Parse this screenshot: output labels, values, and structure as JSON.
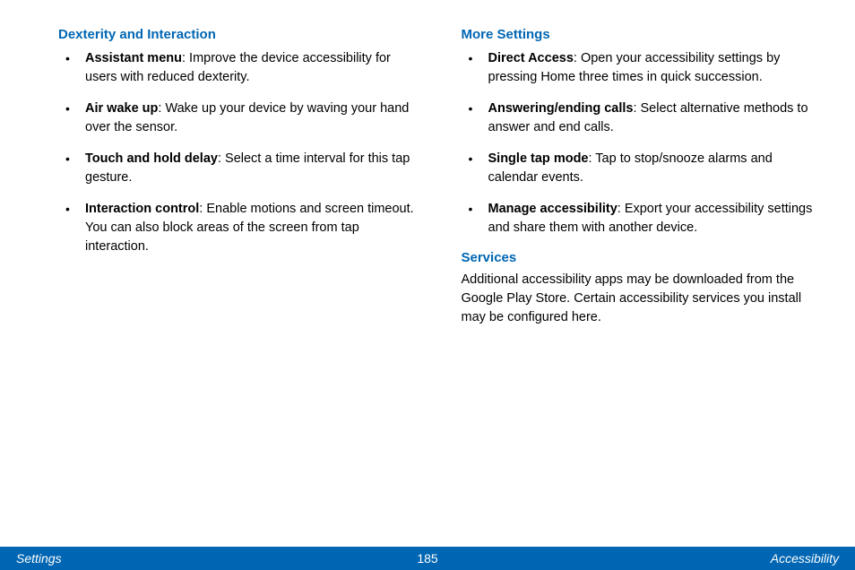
{
  "left": {
    "heading": "Dexterity and Interaction",
    "items": [
      {
        "title": "Assistant menu",
        "desc": ": Improve the device accessibility for users with reduced dexterity."
      },
      {
        "title": "Air wake up",
        "desc": ": Wake up your device by waving your hand over the sensor."
      },
      {
        "title": "Touch and hold delay",
        "desc": ": Select a time interval for this tap gesture."
      },
      {
        "title": "Interaction control",
        "desc": ": Enable motions and screen timeout. You can also block areas of the screen from tap interaction."
      }
    ]
  },
  "right": {
    "heading": "More Settings",
    "items": [
      {
        "title": "Direct Access",
        "desc": ": Open your accessibility settings by pressing Home three times in quick succession."
      },
      {
        "title": "Answering/ending calls",
        "desc": ": Select alternative methods to answer and end calls."
      },
      {
        "title": "Single tap mode",
        "desc": ": Tap to stop/snooze alarms and calendar events."
      },
      {
        "title": "Manage accessibility",
        "desc": ": Export your accessibility settings and share them with another device."
      }
    ],
    "services_heading": "Services",
    "services_body": "Additional accessibility apps may be downloaded from the Google Play Store. Certain accessibility services you install may be configured here."
  },
  "footer": {
    "left": "Settings",
    "center": "185",
    "right": "Accessibility"
  }
}
